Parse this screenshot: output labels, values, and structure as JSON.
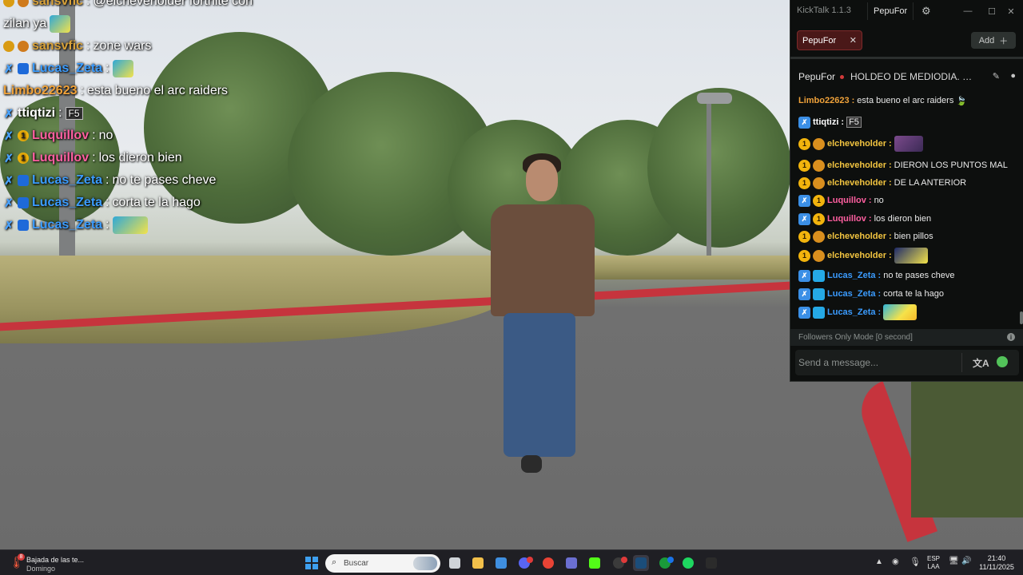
{
  "overlay_chat": {
    "lines": [
      {
        "user": "sansvfic",
        "text": "@elcheveholder fortnite con",
        "badges": [
          "gift",
          "orange"
        ],
        "user_color": "#d8a23a"
      },
      {
        "user": "",
        "text": "zilan ya",
        "badges": [],
        "emote": true
      },
      {
        "user": "sansvfic",
        "text": "zone wars",
        "badges": [
          "gift",
          "orange"
        ],
        "user_color": "#d8a23a"
      },
      {
        "user": "Lucas_Zeta",
        "text": "",
        "badges": [
          "mod",
          "sub"
        ],
        "user_color": "#3b9cff",
        "emote": true
      },
      {
        "user": "Limbo22623",
        "text": "esta bueno el arc raiders",
        "badges": [],
        "user_color": "#f0a23a"
      },
      {
        "user": "ttiqtizi",
        "text": "F5",
        "badges": [
          "mod"
        ],
        "user_color": "#ffffff"
      },
      {
        "user": "Luquillov",
        "text": "no",
        "badges": [
          "mod",
          "one"
        ],
        "user_color": "#ff5fa0"
      },
      {
        "user": "Luquillov",
        "text": "los dieron bien",
        "badges": [
          "mod",
          "one"
        ],
        "user_color": "#ff5fa0"
      },
      {
        "user": "Lucas_Zeta",
        "text": "no te pases cheve",
        "badges": [
          "mod",
          "sub"
        ],
        "user_color": "#3b9cff"
      },
      {
        "user": "Lucas_Zeta",
        "text": "corta te la hago",
        "badges": [
          "mod",
          "sub"
        ],
        "user_color": "#3b9cff"
      },
      {
        "user": "Lucas_Zeta",
        "text": "",
        "badges": [
          "mod",
          "sub"
        ],
        "user_color": "#3b9cff",
        "emote": true
      }
    ]
  },
  "kicktalk": {
    "app_title": "KickTalk 1.1.3",
    "user_button": "PepuFor",
    "window_controls": {
      "minimize": "—",
      "maximize": "☐",
      "close": "✕"
    },
    "tab": {
      "label": "PepuFor",
      "close": "✕"
    },
    "add_button": "Add",
    "channel": {
      "name": "PepuFor",
      "title": "HOLDEO DE MEDIODIA. ME ..."
    },
    "messages": [
      {
        "user": "Limbo22623",
        "text": "esta bueno el arc raiders",
        "badges": [],
        "user_color": "#f0a23a",
        "emote": "leaf"
      },
      {
        "user": "ttiqtizi",
        "text": "F5",
        "badges": [
          "mod"
        ],
        "user_color": "#ffffff"
      },
      {
        "user": "elcheveholder",
        "text": "",
        "badges": [
          "one",
          "gold"
        ],
        "user_color": "#f2c440",
        "emote": "pic"
      },
      {
        "user": "elcheveholder",
        "text": "DIERON LOS PUNTOS MAL",
        "badges": [
          "one",
          "gold"
        ],
        "user_color": "#f2c440"
      },
      {
        "user": "elcheveholder",
        "text": "DE LA ANTERIOR",
        "badges": [
          "one",
          "gold"
        ],
        "user_color": "#f2c440"
      },
      {
        "user": "Luquillov",
        "text": "no",
        "badges": [
          "mod",
          "one"
        ],
        "user_color": "#ff5fa0"
      },
      {
        "user": "Luquillov",
        "text": "los dieron bien",
        "badges": [
          "mod",
          "one"
        ],
        "user_color": "#ff5fa0"
      },
      {
        "user": "elcheveholder",
        "text": "bien pillos",
        "badges": [
          "one",
          "gold"
        ],
        "user_color": "#f2c440"
      },
      {
        "user": "elcheveholder",
        "text": "",
        "badges": [
          "one",
          "gold"
        ],
        "user_color": "#f2c440",
        "emote": "blue"
      },
      {
        "user": "Lucas_Zeta",
        "text": "no te pases cheve",
        "badges": [
          "mod",
          "sub"
        ],
        "user_color": "#3b9cff"
      },
      {
        "user": "Lucas_Zeta",
        "text": "corta te la hago",
        "badges": [
          "mod",
          "sub"
        ],
        "user_color": "#3b9cff"
      },
      {
        "user": "Lucas_Zeta",
        "text": "",
        "badges": [
          "mod",
          "sub"
        ],
        "user_color": "#3b9cff",
        "emote": "yellow"
      }
    ],
    "mode_bar": "Followers Only Mode [0 second]",
    "input_placeholder": "Send a message...",
    "accent_color": "#53c35a"
  },
  "taskbar": {
    "weather": {
      "badge": "8",
      "title": "Bajada de las te...",
      "subtitle": "Domingo"
    },
    "search_label": "Buscar",
    "apps": [
      "file-explorer-icon",
      "files-icon",
      "store-icon",
      "discord-icon",
      "chrome-icon",
      "teams-icon",
      "kick-icon",
      "obs-icon",
      "steam-icon",
      "xbox-icon",
      "spotify-icon",
      "kicktalk-icon"
    ],
    "language": {
      "top": "ESP",
      "bottom": "LAA"
    },
    "clock": {
      "time": "21:40",
      "date": "11/11/2025"
    }
  }
}
